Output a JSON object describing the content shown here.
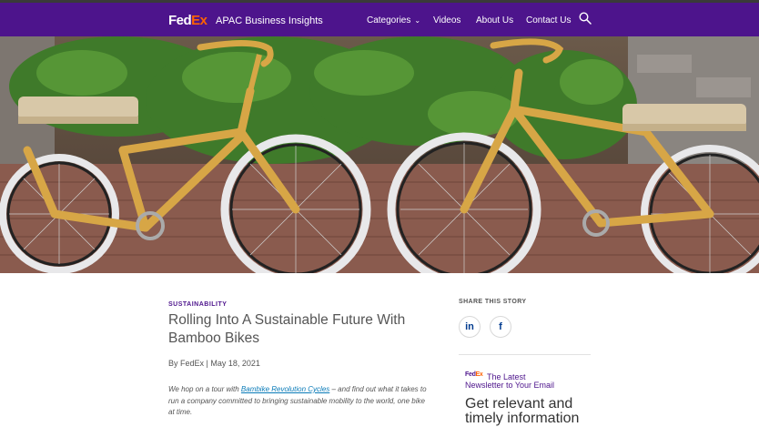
{
  "brand": {
    "logo_fed": "Fed",
    "logo_ex": "Ex",
    "site_title": "APAC Business Insights"
  },
  "nav": {
    "categories": "Categories",
    "videos": "Videos",
    "about": "About Us",
    "contact": "Contact Us"
  },
  "colors": {
    "fedex_purple": "#4d148c",
    "fedex_orange": "#ff6200",
    "link_blue": "#0a7bb8"
  },
  "article": {
    "category": "SUSTAINABILITY",
    "title": "Rolling Into A Sustainable Future With Bamboo Bikes",
    "byline": "By FedEx | May 18, 2021",
    "excerpt_pre": "We hop on a tour with ",
    "excerpt_link": "Bambike Revolution Cycles",
    "excerpt_post": " – and find out what it takes to run a company committed to bringing sustainable mobility to the world, one bike at time."
  },
  "sidebar": {
    "share_label": "SHARE THIS STORY",
    "linkedin_glyph": "in",
    "facebook_glyph": "f",
    "newsletter_logo_fed": "Fed",
    "newsletter_logo_ex": "Ex",
    "newsletter_line1": "The Latest",
    "newsletter_line2": "Newsletter to Your Email",
    "newsletter_heading": "Get relevant and timely information"
  }
}
